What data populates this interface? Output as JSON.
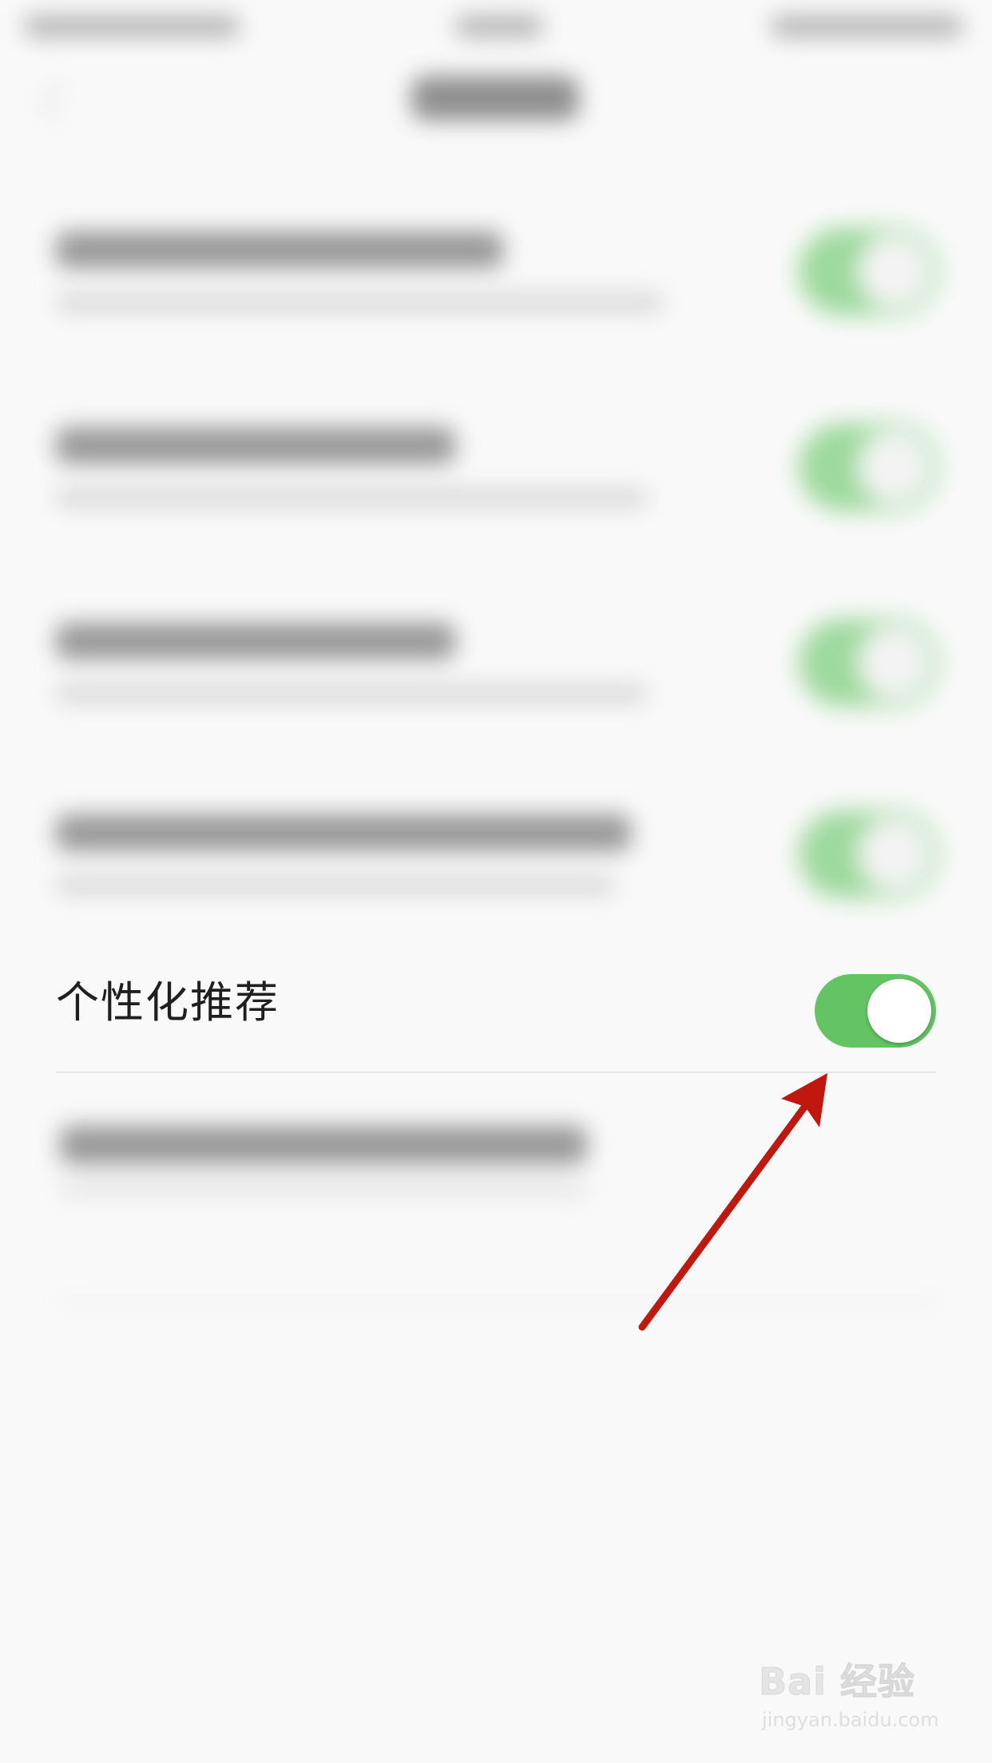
{
  "setting": {
    "label": "个性化推荐",
    "toggle_state": "on"
  },
  "watermark": {
    "logo_text": "Bai 经验",
    "url": "jingyan.baidu.com"
  },
  "colors": {
    "toggle_on": "#62c462",
    "annotation_arrow": "#c0180f",
    "background": "#f9f9f9"
  },
  "icons": {
    "back": "chevron-left-icon",
    "arrow": "annotation-arrow-icon"
  }
}
